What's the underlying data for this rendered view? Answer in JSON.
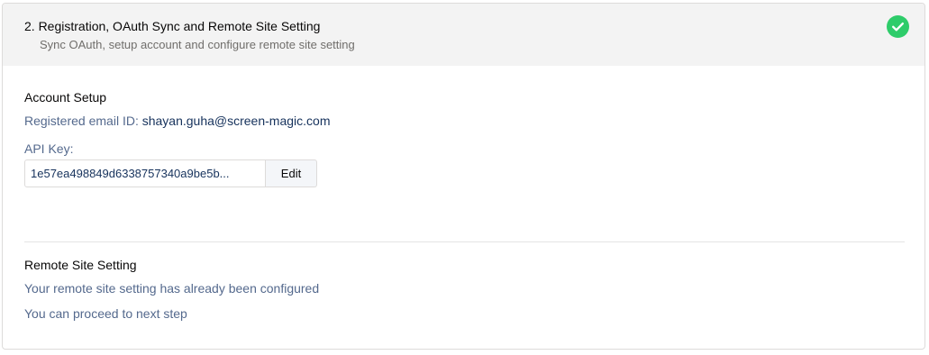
{
  "header": {
    "title": "2. Registration, OAuth Sync and Remote Site Setting",
    "subtitle": "Sync OAuth, setup account and configure remote site setting",
    "status_icon": "check-circle-icon",
    "status_color": "#2ecc6a"
  },
  "account_setup": {
    "title": "Account Setup",
    "email_label": "Registered email ID: ",
    "email_value": "shayan.guha@screen-magic.com",
    "api_key_label": "API Key:",
    "api_key_value": "1e57ea498849d6338757340a9be5b...",
    "edit_label": "Edit"
  },
  "remote_site": {
    "title": "Remote Site Setting",
    "message": "Your remote site setting has already been configured",
    "next_step": "You can proceed to next step"
  }
}
